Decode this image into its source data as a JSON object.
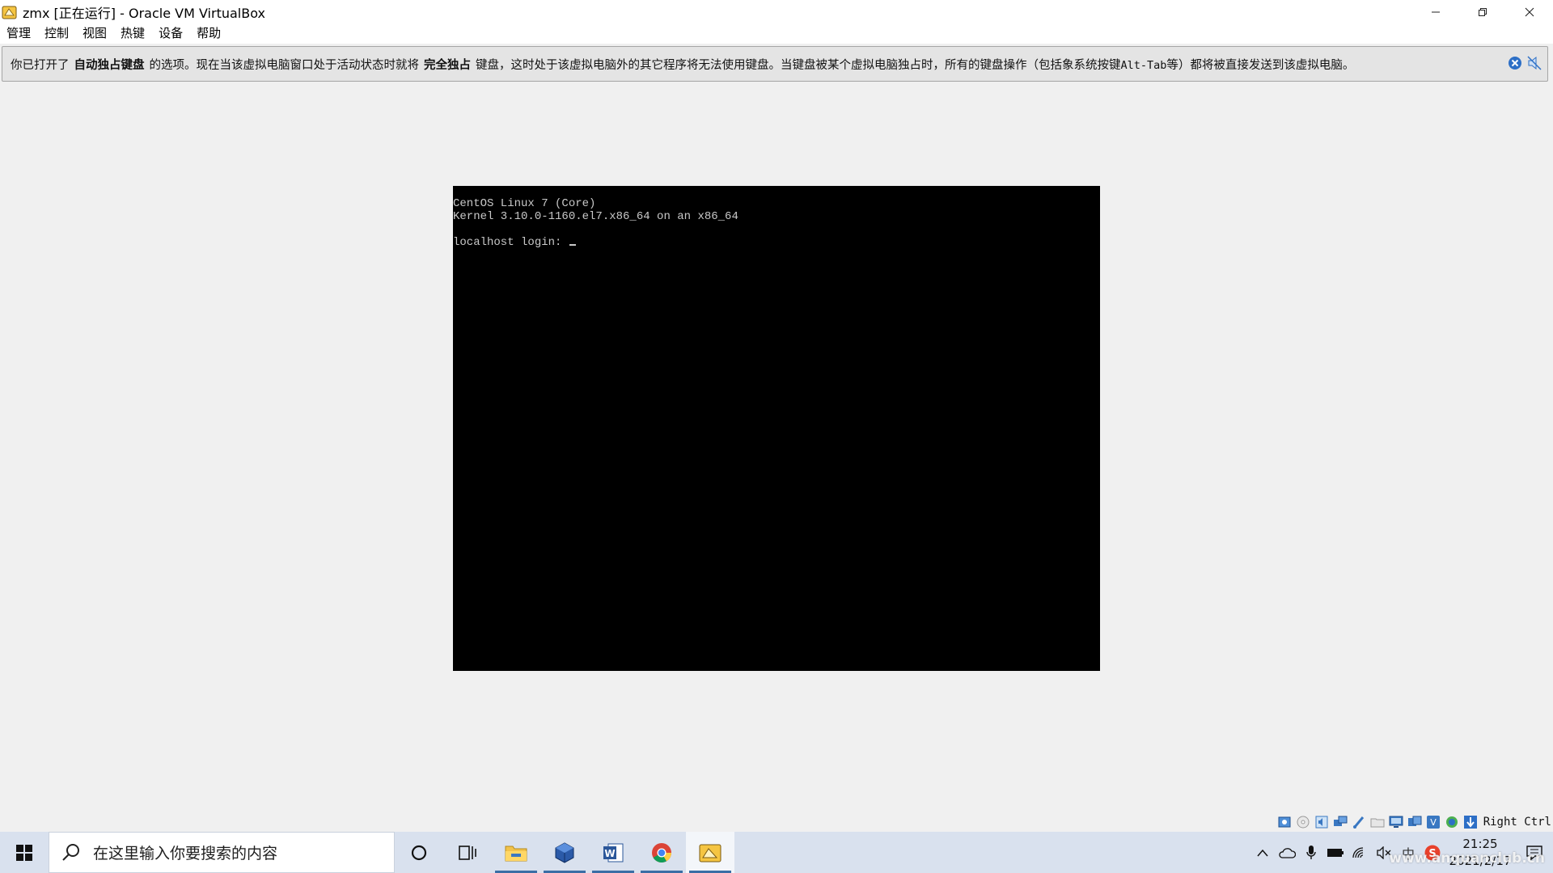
{
  "window": {
    "title": "zmx [正在运行] - Oracle VM VirtualBox",
    "controls": [
      "minimize",
      "restore",
      "close"
    ]
  },
  "menu": {
    "items": [
      {
        "label": "管理"
      },
      {
        "label": "控制"
      },
      {
        "label": "视图"
      },
      {
        "label": "热键"
      },
      {
        "label": "设备"
      },
      {
        "label": "帮助"
      }
    ]
  },
  "notice": {
    "part1": "你已打开了",
    "bold1": "自动独占键盘",
    "part2": "的选项。现在当该虚拟电脑窗口处于活动状态时就将",
    "bold2": "完全独占",
    "part3": "键盘，这时处于该虚拟电脑外的其它程序将无法使用键盘。当键盘被某个虚拟电脑独占时，所有的键盘操作（包括象系统按键",
    "mono": "Alt-Tab",
    "part4": "等）都将被直接发送到该虚拟电脑。"
  },
  "console": {
    "line1": "CentOS Linux 7 (Core)",
    "line2": "Kernel 3.10.0-1160.el7.x86_64 on an x86_64",
    "line3": "",
    "line4": "localhost login: "
  },
  "vm_status": {
    "host_key": "Right Ctrl"
  },
  "taskbar": {
    "search_placeholder": "在这里输入你要搜索的内容",
    "apps": [
      "file-explorer",
      "virtualbox",
      "word",
      "chrome",
      "virtualbox-vm"
    ]
  },
  "tray": {
    "ime": "中",
    "time": "21:25",
    "date": "2021/2/17"
  },
  "watermark": "www.anquanclub.cn",
  "colors": {
    "vm_screen": "#000000",
    "console_text": "#c8c8c8",
    "taskbar": "#d9e1ee",
    "background": "#f0f0f0"
  }
}
